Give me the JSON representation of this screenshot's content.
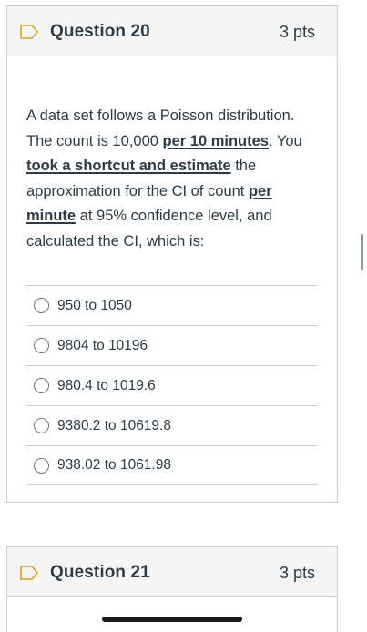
{
  "question20": {
    "title": "Question 20",
    "points": "3 pts",
    "text": {
      "p1": "A data set follows a Poisson distribution. The count is 10,000 ",
      "u1": "per 10 minutes",
      "p2": ". You ",
      "u2": "took a shortcut and estimate",
      "p3": " the approximation for the CI of count ",
      "u3": "per minute",
      "p4": " at 95% confidence level, and calculated the CI, which is:"
    },
    "answers": [
      {
        "label": "950 to 1050"
      },
      {
        "label": "9804 to 10196"
      },
      {
        "label": "980.4 to 1019.6"
      },
      {
        "label": "9380.2 to 10619.8"
      },
      {
        "label": "938.02 to 1061.98"
      }
    ]
  },
  "question21": {
    "title": "Question 21",
    "points": "3 pts"
  },
  "icons": {
    "flag": "flag-icon",
    "radio": "radio-button-icon"
  },
  "colors": {
    "text": "#2d3b45",
    "border": "#c7cdd1",
    "header_bg": "#f5f5f5"
  }
}
